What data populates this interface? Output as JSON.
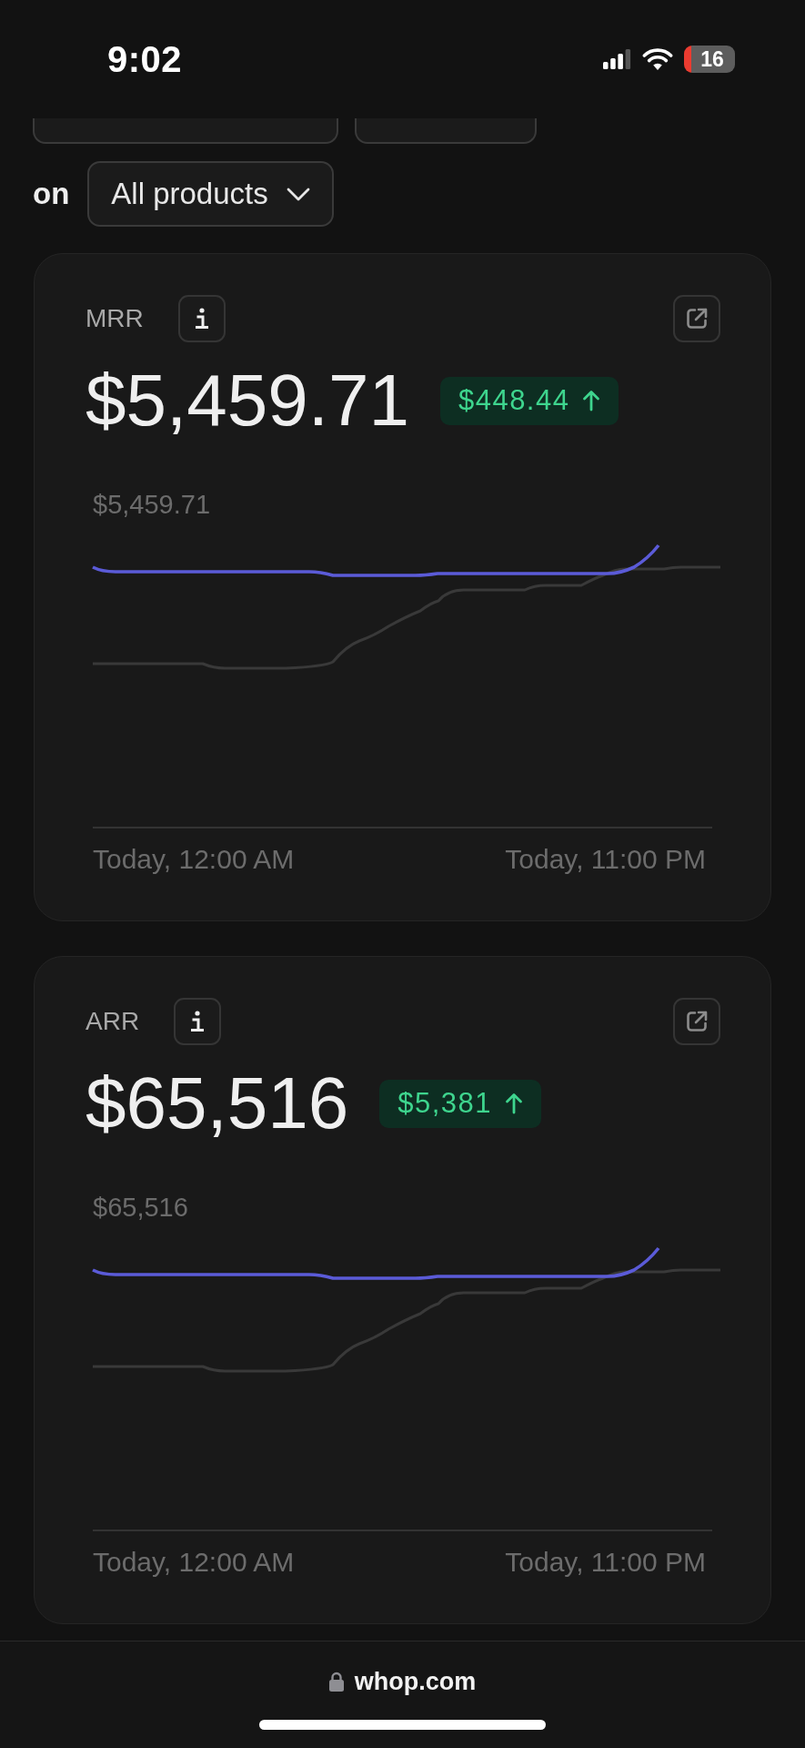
{
  "status_bar": {
    "time": "9:02",
    "battery": "16"
  },
  "clipped_controls": [
    {
      "kind": "wide"
    },
    {
      "kind": "narrow"
    }
  ],
  "filter": {
    "prefix": "on",
    "dropdown": "All products"
  },
  "metrics": [
    {
      "title": "MRR",
      "value": "$5,459.71",
      "change": "$448.44",
      "increase": true,
      "chart": {
        "top_label": "$5,459.71",
        "x_start": "Today, 12:00 AM",
        "x_end": "Today, 11:00 PM"
      }
    },
    {
      "title": "ARR",
      "value": "$65,516",
      "change": "$5,381",
      "increase": true,
      "chart": {
        "top_label": "$65,516",
        "x_start": "Today, 12:00 AM",
        "x_end": "Today, 11:00 PM"
      }
    }
  ],
  "browser_bar": {
    "url": "whop.com"
  }
}
